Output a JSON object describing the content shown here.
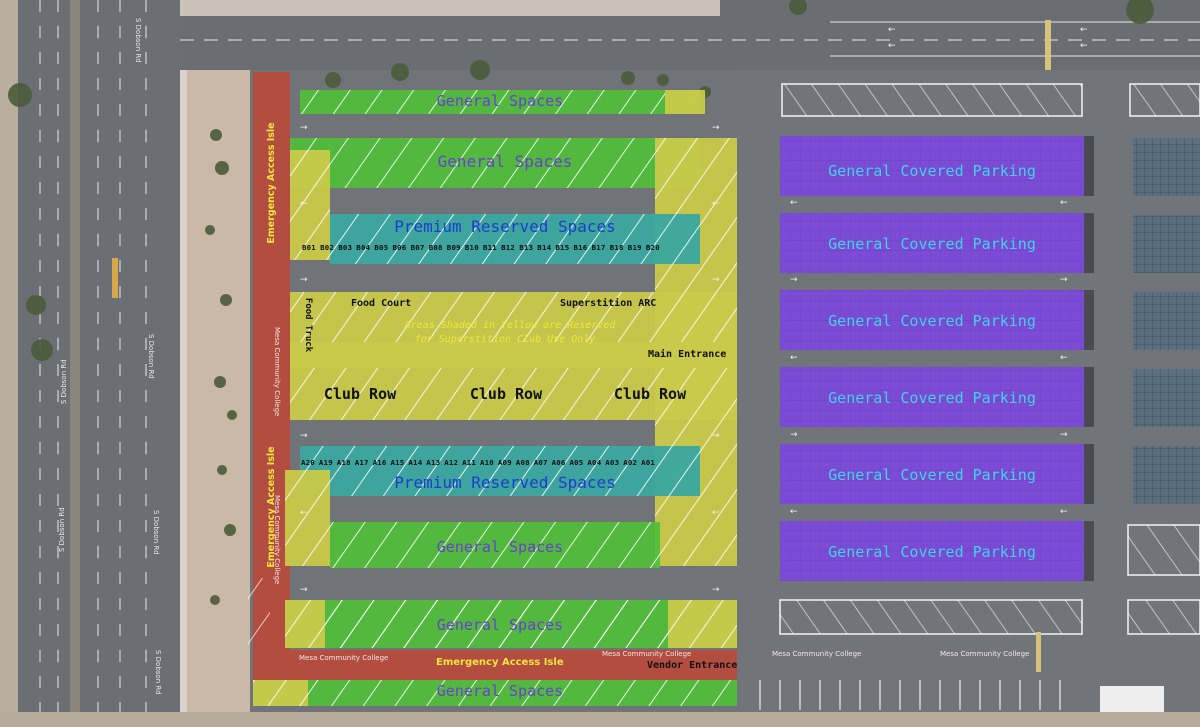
{
  "colors": {
    "general": "#4fbf3a",
    "premium": "#3aa7a0",
    "covered": "#7b4bd6",
    "reserved_yellow": "#c9c94a",
    "emergency": "#b84a3c",
    "asphalt": "#6e7276",
    "general_text": "#6a3fd0",
    "premium_text": "#1a3fd0",
    "covered_text": "#3fd4e6",
    "yellow_text": "#f1e63a"
  },
  "labels": {
    "general_1": "General Spaces",
    "general_2": "General Spaces",
    "premium_top": "Premium Reserved Spaces",
    "premium_bottom": "Premium Reserved Spaces",
    "general_3": "General Spaces",
    "general_4": "General Spaces",
    "general_5": "General Spaces",
    "food_court": "Food Court",
    "superstition_arc": "Superstition ARC",
    "food_truck": "Food Truck",
    "yellow_note_1": "Areas Shaded in Yellow are Reserved",
    "yellow_note_2": "for Superstition Club Use Only",
    "main_entrance": "Main Entrance",
    "club_row_1": "Club Row",
    "club_row_2": "Club Row",
    "club_row_3": "Club Row",
    "emergency_top": "Emergency Access Isle",
    "emergency_mid": "Emergency Access Isle",
    "emergency_bottom": "Emergency Access Isle",
    "vendor_entrance": "Vendor Entrance",
    "covered": [
      "General Covered Parking",
      "General Covered Parking",
      "General Covered Parking",
      "General Covered Parking",
      "General Covered Parking",
      "General Covered Parking"
    ]
  },
  "stalls_top": [
    "B01",
    "B02",
    "B03",
    "B04",
    "B05",
    "B06",
    "B07",
    "B08",
    "B09",
    "B10",
    "B11",
    "B12",
    "B13",
    "B14",
    "B15",
    "B16",
    "B17",
    "B18",
    "B19",
    "B20"
  ],
  "stalls_bottom": [
    "A20",
    "A19",
    "A18",
    "A17",
    "A16",
    "A15",
    "A14",
    "A13",
    "A12",
    "A11",
    "A10",
    "A09",
    "A08",
    "A07",
    "A06",
    "A05",
    "A04",
    "A03",
    "A02",
    "A01"
  ],
  "map_labels": {
    "road_1": "S Dobson Rd",
    "road_2": "S Dobson Rd",
    "road_3": "S Dobson Rd",
    "road_4": "S Dobson Rd",
    "road_5": "S Dobson Rd",
    "road_6": "S Dobson Rd",
    "mcc_1": "Mesa Community College",
    "mcc_2": "Mesa Community College",
    "mcc_3": "Mesa Community College",
    "mcc_4": "Mesa Community College",
    "mcc_5": "Mesa Community College",
    "mcc_6": "Mesa Community College"
  }
}
